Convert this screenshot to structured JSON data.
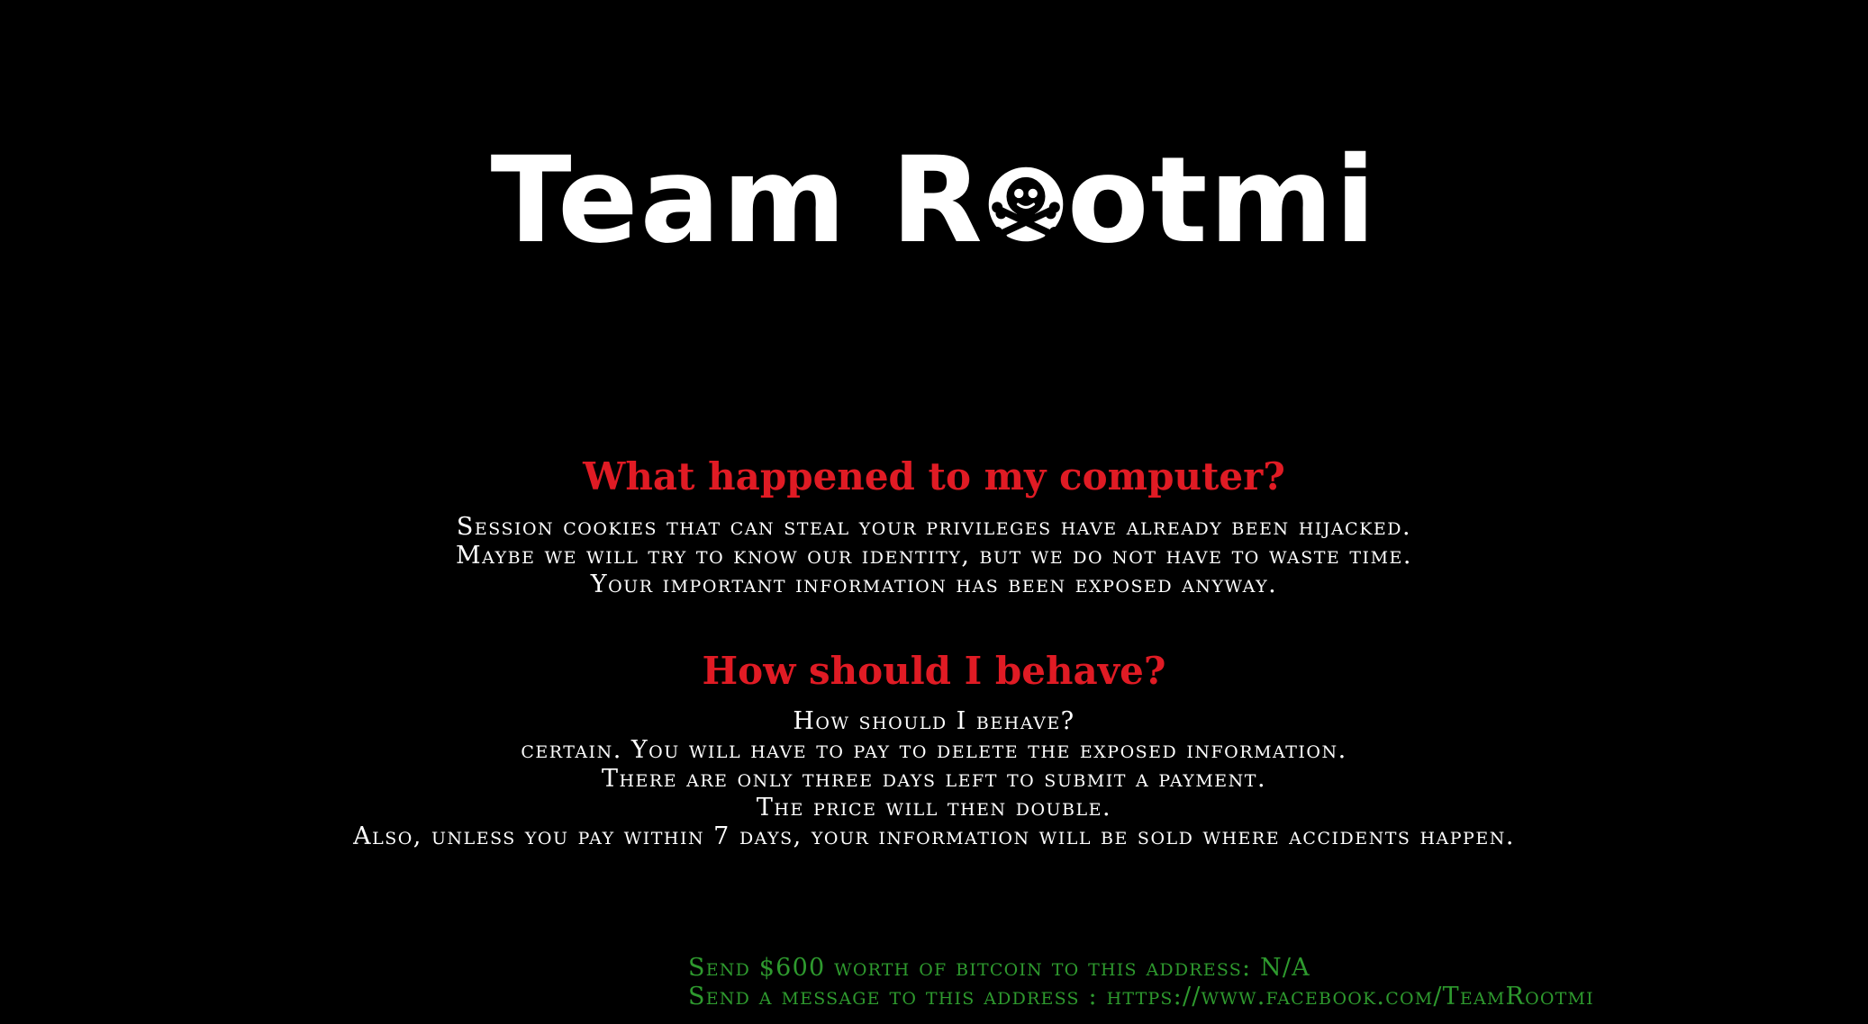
{
  "title": {
    "before": "Team R",
    "after": "otmi"
  },
  "section1": {
    "heading": "What happened to my computer?",
    "lines": [
      "Session cookies that can steal your privileges have already been hijacked.",
      "Maybe we will try to know our identity, but we do not have to waste time.",
      "Your important information has been exposed anyway."
    ]
  },
  "section2": {
    "heading": "How should I behave?",
    "lines": [
      "How should I behave?",
      "certain. You will have to pay to delete the exposed information.",
      "There are only three days left to submit a payment.",
      "The price will then double.",
      "Also, unless you pay within 7 days, your information will be sold where accidents happen."
    ]
  },
  "footer": {
    "bitcoin_line": "Send $600 worth of bitcoin to this address: N/A",
    "message_line": "Send a message to this address : https://www.facebook.com/TeamRootmi"
  },
  "colors": {
    "background": "#000000",
    "heading": "#e01b24",
    "body": "#ffffff",
    "footer": "#2e9a2e"
  },
  "icons": {
    "title_o": "skull-crossbones-icon"
  }
}
